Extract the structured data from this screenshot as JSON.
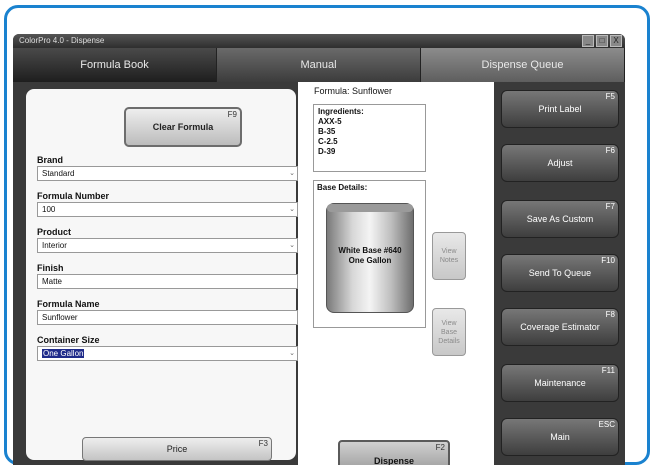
{
  "window": {
    "title": "ColorPro 4.0 - Dispense",
    "buttons": [
      "_",
      "□",
      "X"
    ]
  },
  "tabs": [
    {
      "label": "Formula Book"
    },
    {
      "label": "Manual"
    },
    {
      "label": "Dispense Queue"
    }
  ],
  "left": {
    "clear": {
      "label": "Clear Formula",
      "key": "F9"
    },
    "brand": {
      "label": "Brand",
      "value": "Standard"
    },
    "formula_number": {
      "label": "Formula Number",
      "value": "100"
    },
    "product": {
      "label": "Product",
      "value": "Interior"
    },
    "finish": {
      "label": "Finish",
      "value": "Matte"
    },
    "formula_name": {
      "label": "Formula Name",
      "value": "Sunflower"
    },
    "container_size": {
      "label": "Container Size",
      "value": "One Gallon"
    },
    "price": {
      "label": "Price",
      "key": "F3"
    }
  },
  "middle": {
    "formula_title": "Formula: Sunflower",
    "ingredients_title": "Ingredients:",
    "ingredients": [
      "AXX-5",
      "B-35",
      "C-2.5",
      "D-39"
    ],
    "base_title": "Base Details:",
    "base_line1": "White Base #640",
    "base_line2": "One Gallon",
    "view_notes": "View Notes",
    "view_base_details": "View Base Details",
    "dispense": {
      "label": "Dispense",
      "key": "F2"
    }
  },
  "right": [
    {
      "label": "Print Label",
      "key": "F5"
    },
    {
      "label": "Adjust",
      "key": "F6"
    },
    {
      "label": "Save As Custom",
      "key": "F7"
    },
    {
      "label": "Send To Queue",
      "key": "F10"
    },
    {
      "label": "Coverage Estimator",
      "key": "F8"
    },
    {
      "label": "Maintenance",
      "key": "F11"
    },
    {
      "label": "Main",
      "key": "ESC"
    }
  ]
}
